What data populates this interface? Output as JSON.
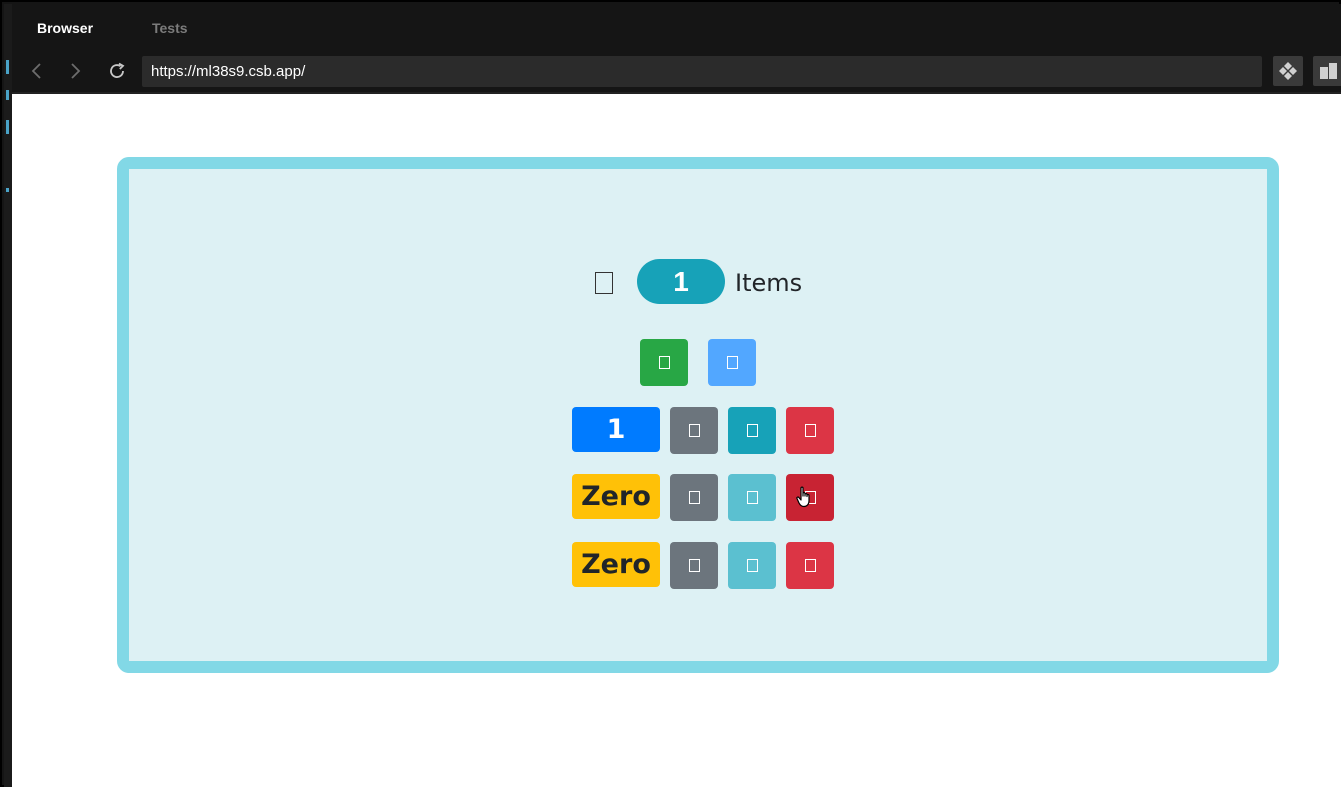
{
  "browser": {
    "tabs": [
      {
        "label": "Browser",
        "active": true
      },
      {
        "label": "Tests",
        "active": false
      }
    ],
    "url": "https://ml38s9.csb.app/"
  },
  "app": {
    "header": {
      "icon": "square-icon",
      "count": "1",
      "label": "Items"
    },
    "top_buttons": [
      {
        "icon": "square-icon",
        "color": "#28a745"
      },
      {
        "icon": "square-icon",
        "color": "#52a7ff"
      }
    ],
    "rows": [
      {
        "label": "1",
        "label_color": "#007bff",
        "label_text_color": "#ffffff",
        "buttons": [
          {
            "icon": "square-icon",
            "color": "#6c757d"
          },
          {
            "icon": "square-icon",
            "color": "#17a2b8"
          },
          {
            "icon": "square-icon",
            "color": "#dc3545"
          }
        ]
      },
      {
        "label": "Zero",
        "label_color": "#ffc107",
        "label_text_color": "#212529",
        "buttons": [
          {
            "icon": "square-icon",
            "color": "#6c757d"
          },
          {
            "icon": "square-icon",
            "color": "#5bc0d0"
          },
          {
            "icon": "square-icon",
            "color": "#c82333"
          }
        ]
      },
      {
        "label": "Zero",
        "label_color": "#ffc107",
        "label_text_color": "#212529",
        "buttons": [
          {
            "icon": "square-icon",
            "color": "#6c757d"
          },
          {
            "icon": "square-icon",
            "color": "#5bc0d0"
          },
          {
            "icon": "square-icon",
            "color": "#dc3545"
          }
        ]
      }
    ]
  }
}
